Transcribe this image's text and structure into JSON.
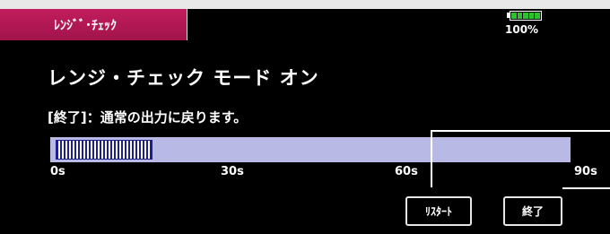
{
  "header": {
    "mode_tab_label": "ﾚﾝｼﾞﾞ･ﾁｪｯｸ",
    "battery_text": "100%",
    "battery_level_percent": 100,
    "battery_icon": "battery-icon"
  },
  "main": {
    "title": "レンジ・チェック モード オン",
    "description": "[終了]：通常の出力に戻ります。"
  },
  "progress": {
    "fill_fraction": 0.19,
    "ticks": [
      "0s",
      "30s",
      "60s",
      "90s"
    ]
  },
  "buttons": {
    "restart_label": "ﾘｽﾀｰﾄ",
    "end_label": "終了"
  },
  "colors": {
    "accent": "#b0174f",
    "bar_background": "#b9b9e6",
    "bar_fill": "#1e1e8c",
    "battery_green": "#2ec12e"
  }
}
